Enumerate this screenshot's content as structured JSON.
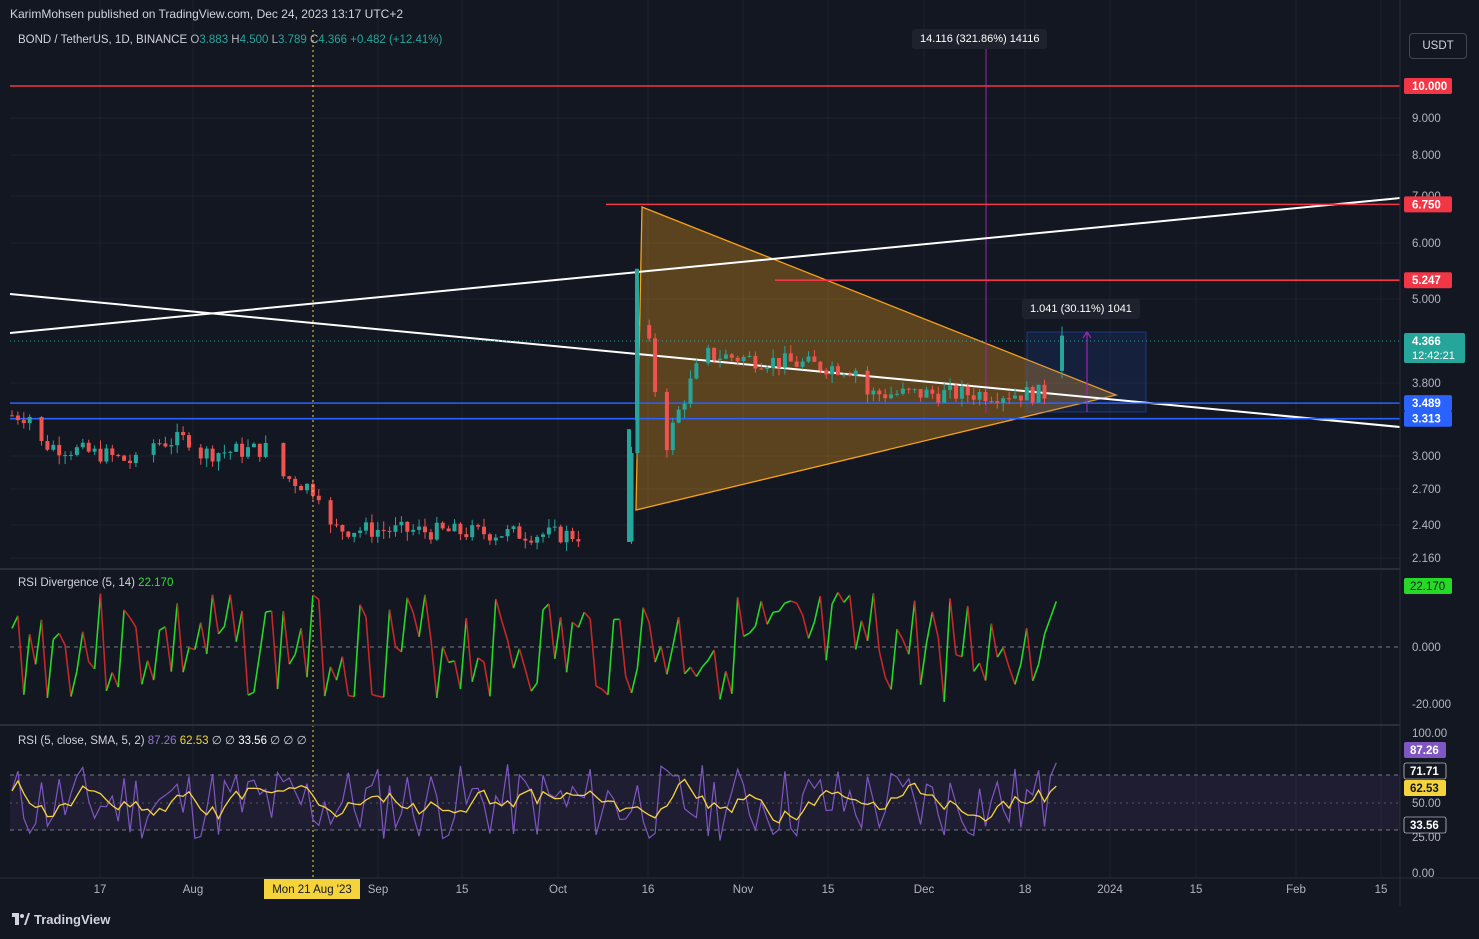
{
  "header": {
    "published": "KarimMohsen published on TradingView.com, Dec 24, 2023 13:17 UTC+2"
  },
  "symbol": {
    "name": "BOND / TetherUS, 1D, BINANCE",
    "o_label": "O",
    "o": "3.883",
    "h_label": "H",
    "h": "4.500",
    "l_label": "L",
    "l": "3.789",
    "c_label": "C",
    "c": "4.366",
    "change": "+0.482 (+12.41%)"
  },
  "currency": "USDT",
  "measures": {
    "big": "14.116 (321.86%) 14116",
    "small": "1.041 (30.11%) 1041"
  },
  "price_axis": {
    "ticks": [
      "9.000",
      "8.000",
      "7.000",
      "6.000",
      "5.000",
      "3.800",
      "3.000",
      "2.700",
      "2.400",
      "2.160"
    ],
    "levels": [
      {
        "label": "10.000",
        "value": 10.0,
        "color": "#f23645"
      },
      {
        "label": "6.750",
        "value": 6.75,
        "color": "#f23645"
      },
      {
        "label": "5.247",
        "value": 5.247,
        "color": "#f23645"
      },
      {
        "label": "3.489",
        "value": 3.489,
        "color": "#2962ff"
      },
      {
        "label": "3.313",
        "value": 3.313,
        "color": "#2962ff"
      }
    ],
    "last_price": "4.366",
    "countdown": "12:42:21"
  },
  "time_axis": {
    "labels": [
      "17",
      "Aug",
      "Sep",
      "15",
      "Oct",
      "16",
      "Nov",
      "15",
      "Dec",
      "18",
      "2024",
      "15",
      "Feb",
      "15"
    ],
    "crosshair_label": "Mon 21 Aug '23"
  },
  "rsi_div": {
    "title": "RSI Divergence (5, 14)",
    "value": "22.170",
    "ticks": [
      "0.000",
      "-20.000"
    ],
    "colors": {
      "up": "#26d926",
      "down": "#c62828"
    }
  },
  "rsi": {
    "title": "RSI (5, close, SMA, 5, 2)",
    "v1": "87.26",
    "v2": "62.53",
    "sep1": "∅",
    "sep2": "∅",
    "v3": "33.56",
    "sep3": "∅",
    "sep4": "∅",
    "sep5": "∅",
    "ticks": [
      "100.00",
      "50.00",
      "25.00",
      "0.00"
    ],
    "badges": [
      "87.26",
      "71.71",
      "62.53",
      "33.56"
    ]
  },
  "footer": {
    "brand": "TradingView"
  },
  "chart_data": {
    "type": "candlestick",
    "symbol": "BOND / TetherUS",
    "interval": "1D",
    "ylim": [
      2.1,
      10.5
    ],
    "last": {
      "open": 3.883,
      "high": 4.5,
      "low": 3.789,
      "close": 4.366
    },
    "horizontal_levels": [
      10.0,
      6.75,
      5.247,
      3.489,
      3.313
    ],
    "indicators": [
      {
        "name": "RSI Divergence (5, 14)",
        "last": 22.17
      },
      {
        "name": "RSI (5, close, SMA, 5, 2)",
        "rsi": 87.26,
        "sma": 62.53,
        "lower": 33.56,
        "upper": 71.71
      }
    ],
    "colors": {
      "up": "#26a69a",
      "down": "#ef5350",
      "triangle": "#f7a21a",
      "level": "#f23645",
      "support": "#2962ff"
    }
  }
}
